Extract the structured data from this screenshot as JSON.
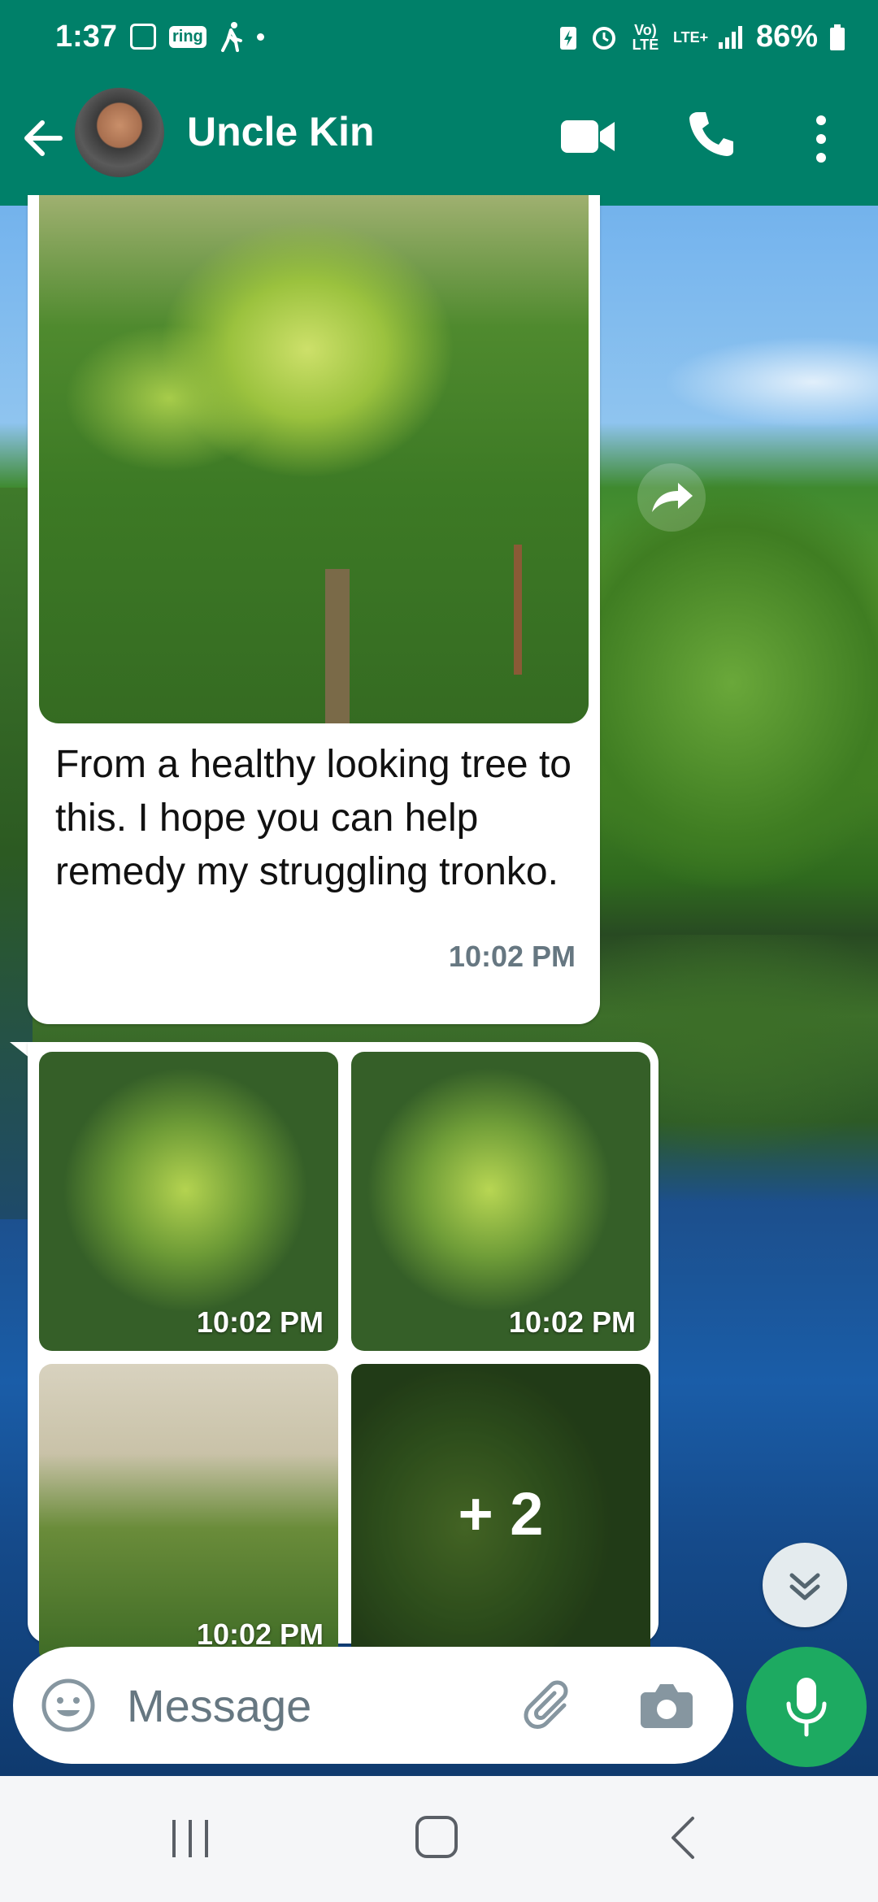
{
  "status_bar": {
    "time": "1:37",
    "left_icons": [
      "gallery-icon",
      "ring-icon",
      "walking-icon",
      "dot-icon"
    ],
    "ring_label": "ring",
    "right_icons": [
      "battery-saver-icon",
      "alarm-icon",
      "volte-icon",
      "lte-icon",
      "signal-icon",
      "battery-icon"
    ],
    "volte_label": "Vo) LTE",
    "lte_label": "LTE+",
    "battery_percent": "86%"
  },
  "header": {
    "contact_name": "Uncle Kin",
    "icons": [
      "back-arrow-icon",
      "avatar",
      "video-call-icon",
      "voice-call-icon",
      "more-options-icon"
    ]
  },
  "messages": [
    {
      "type": "image-with-caption",
      "image": "mango-tree-photo",
      "caption": "From a healthy looking tree to this. I hope you can help remedy my struggling tronko.",
      "time": "10:02 PM"
    },
    {
      "type": "image-album",
      "images": [
        {
          "time": "10:02 PM"
        },
        {
          "time": "10:02 PM"
        },
        {
          "time": "10:02 PM"
        },
        {
          "more_count": "+ 2"
        }
      ]
    }
  ],
  "composer": {
    "placeholder": "Message",
    "icons": [
      "emoji-icon",
      "attach-icon",
      "camera-icon",
      "mic-icon"
    ]
  },
  "scroll_button": "chevrons-down-icon",
  "nav_bar": [
    "recent-apps-icon",
    "home-icon",
    "back-icon"
  ],
  "colors": {
    "header_bg": "#008069",
    "mic_button": "#1daa61",
    "timestamp_gray": "#667781"
  }
}
